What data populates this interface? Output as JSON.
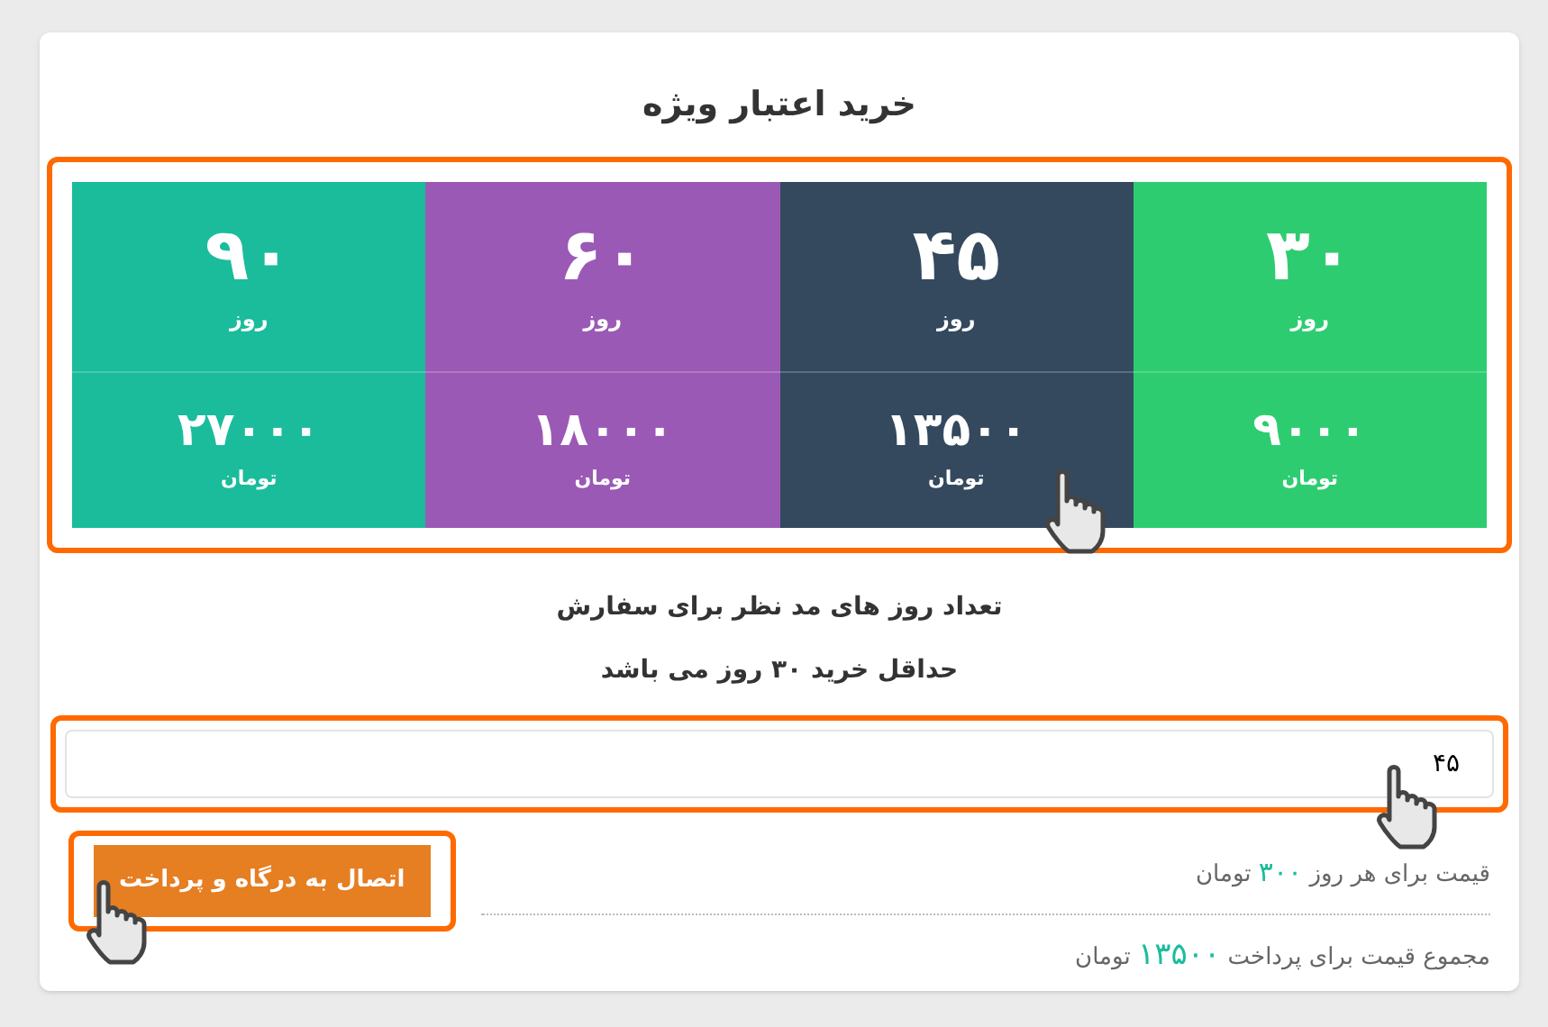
{
  "title": "خرید اعتبار ویژه",
  "plans": [
    {
      "days": "۳۰",
      "days_unit": "روز",
      "price": "۹۰۰۰",
      "currency": "تومان",
      "color": "#2ecc71"
    },
    {
      "days": "۴۵",
      "days_unit": "روز",
      "price": "۱۳۵۰۰",
      "currency": "تومان",
      "color": "#34495e"
    },
    {
      "days": "۶۰",
      "days_unit": "روز",
      "price": "۱۸۰۰۰",
      "currency": "تومان",
      "color": "#9b59b6"
    },
    {
      "days": "۹۰",
      "days_unit": "روز",
      "price": "۲۷۰۰۰",
      "currency": "تومان",
      "color": "#1abc9c"
    }
  ],
  "instructions": [
    "تعداد روز های مد نظر برای سفارش",
    "حداقل خرید ۳۰ روز می باشد"
  ],
  "days_input": {
    "value": "۴۵"
  },
  "per_day_price": {
    "label": "قیمت برای هر روز",
    "amount": "۳۰۰",
    "currency": "تومان"
  },
  "total_price": {
    "label": "مجموع قیمت برای پرداخت",
    "amount": "۱۳۵۰۰",
    "currency": "تومان"
  },
  "pay_button": {
    "label": "اتصال به درگاه و پرداخت"
  }
}
